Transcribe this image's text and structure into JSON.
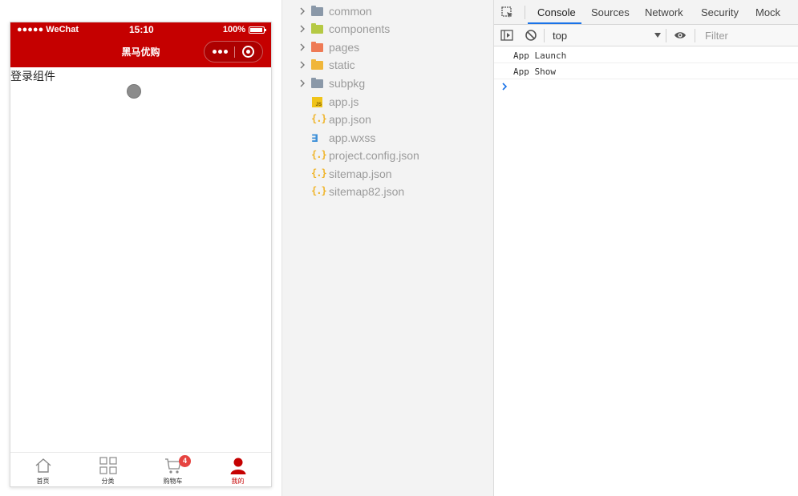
{
  "simulator": {
    "status_bar": {
      "carrier": "●●●●● WeChat",
      "time": "15:10",
      "battery": "100%"
    },
    "nav_title": "黑马优购",
    "page_text": "登录组件",
    "tabbar": [
      {
        "label": "首页",
        "icon": "home-icon"
      },
      {
        "label": "分类",
        "icon": "grid-icon"
      },
      {
        "label": "购物车",
        "icon": "cart-icon",
        "badge": "4"
      },
      {
        "label": "我的",
        "icon": "user-icon"
      }
    ],
    "colors": {
      "nav_bg": "#c50000",
      "active_tab": "#c50000",
      "badge": "#e64340"
    }
  },
  "file_tree": {
    "items": [
      {
        "name": "common",
        "type": "folder",
        "icon": "folder-icon"
      },
      {
        "name": "components",
        "type": "folder",
        "icon": "components-folder-icon"
      },
      {
        "name": "pages",
        "type": "folder",
        "icon": "pages-folder-icon"
      },
      {
        "name": "static",
        "type": "folder",
        "icon": "static-folder-icon"
      },
      {
        "name": "subpkg",
        "type": "folder",
        "icon": "folder-icon"
      },
      {
        "name": "app.js",
        "type": "file",
        "icon": "js-file-icon"
      },
      {
        "name": "app.json",
        "type": "file",
        "icon": "json-file-icon"
      },
      {
        "name": "app.wxss",
        "type": "file",
        "icon": "css-file-icon"
      },
      {
        "name": "project.config.json",
        "type": "file",
        "icon": "json-file-icon"
      },
      {
        "name": "sitemap.json",
        "type": "file",
        "icon": "json-file-icon"
      },
      {
        "name": "sitemap82.json",
        "type": "file",
        "icon": "json-file-icon"
      }
    ]
  },
  "devtools": {
    "tabs": [
      "Console",
      "Sources",
      "Network",
      "Security",
      "Mock"
    ],
    "active_tab": "Console",
    "context": "top",
    "filter_placeholder": "Filter",
    "console_lines": [
      "App Launch",
      "App Show"
    ],
    "colors": {
      "accent": "#1a73e8"
    }
  }
}
